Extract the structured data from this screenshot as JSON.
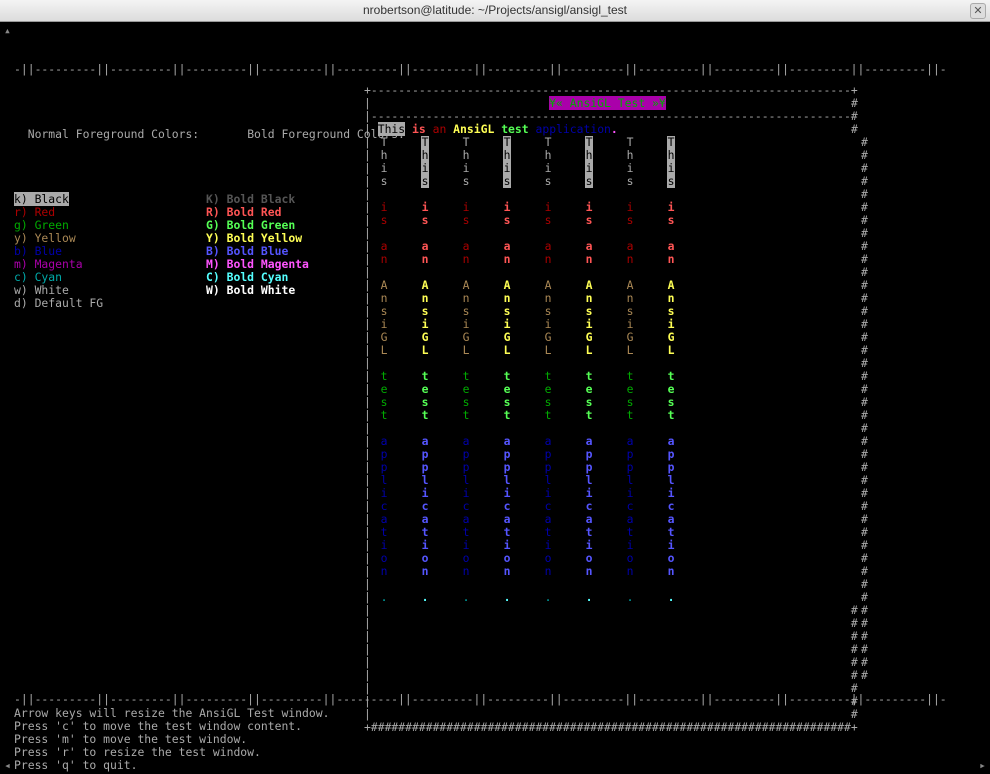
{
  "window": {
    "title": "nrobertson@latitude: ~/Projects/ansigl/ansigl_test"
  },
  "scroll": {
    "up": "▴",
    "left": "◂",
    "right": "▸"
  },
  "ruler": "-||---------||---------||---------||---------||---------||---------||---------||---------||---------||---------||---------||---------||-",
  "headers": {
    "normal": "Normal Foreground Colors:",
    "bold": "Bold Foreground Colors:"
  },
  "normal_colors": [
    {
      "key": "k)",
      "name": "Black",
      "cls": "hl-wht"
    },
    {
      "key": "r)",
      "name": "Red",
      "cls": "red"
    },
    {
      "key": "g)",
      "name": "Green",
      "cls": "grn"
    },
    {
      "key": "y)",
      "name": "Yellow",
      "cls": "ylw"
    },
    {
      "key": "b)",
      "name": "Blue",
      "cls": "blu"
    },
    {
      "key": "m)",
      "name": "Magenta",
      "cls": "mag"
    },
    {
      "key": "c)",
      "name": "Cyan",
      "cls": "cyn"
    },
    {
      "key": "w)",
      "name": "White",
      "cls": "wht"
    },
    {
      "key": "d)",
      "name": "Default FG",
      "cls": "wht"
    }
  ],
  "bold_colors": [
    {
      "key": "K)",
      "name": "Bold Black",
      "cls": "bblk"
    },
    {
      "key": "R)",
      "name": "Bold Red",
      "cls": "bred"
    },
    {
      "key": "G)",
      "name": "Bold Green",
      "cls": "bgrn"
    },
    {
      "key": "Y)",
      "name": "Bold Yellow",
      "cls": "bylw"
    },
    {
      "key": "B)",
      "name": "Bold Blue",
      "cls": "bblu"
    },
    {
      "key": "M)",
      "name": "Bold Magenta",
      "cls": "bmag"
    },
    {
      "key": "C)",
      "name": "Bold Cyan",
      "cls": "bcyn"
    },
    {
      "key": "W)",
      "name": "Bold White",
      "cls": "bwht"
    }
  ],
  "panel": {
    "top": "+----------------------------------------------------------------------+",
    "title": "¥« AnsiGL Test »¥",
    "divider": "|----------------------------------------------------------------------|",
    "bottom": "+######################################################################+",
    "pipe": "|",
    "hash": "#"
  },
  "sentence": [
    {
      "t": "This",
      "cls": "hl-wht"
    },
    {
      "t": " ",
      "cls": ""
    },
    {
      "t": "is",
      "cls": "bred"
    },
    {
      "t": " ",
      "cls": ""
    },
    {
      "t": "an",
      "cls": "red"
    },
    {
      "t": " ",
      "cls": ""
    },
    {
      "t": "AnsiGL",
      "cls": "bylw"
    },
    {
      "t": " ",
      "cls": ""
    },
    {
      "t": "test",
      "cls": "bgrn"
    },
    {
      "t": " ",
      "cls": ""
    },
    {
      "t": "application",
      "cls": "blu"
    },
    {
      "t": ".",
      "cls": "bmag"
    }
  ],
  "vwords": [
    {
      "word": "This",
      "base": "wht",
      "hl": "hl-wht"
    },
    {
      "word": "is",
      "base": "red",
      "hl": "bred"
    },
    {
      "word": "an",
      "base": "red",
      "hl": "red"
    },
    {
      "word": "AnsiGL",
      "base": "ylw",
      "hl": "bylw"
    },
    {
      "word": "test",
      "base": "grn",
      "hl": "bgrn"
    },
    {
      "word": "application",
      "base": "blu",
      "hl": "blu"
    },
    {
      "word": ".",
      "base": "cyn",
      "hl": "bmag"
    }
  ],
  "vcol_styles": [
    "",
    "b",
    "",
    "b",
    "",
    "b",
    "",
    "b"
  ],
  "help": [
    "Arrow keys will resize the AnsiGL Test window.",
    "Press 'c' to move the test window content.",
    "Press 'm' to move the test window.",
    "Press 'r' to resize the test window.",
    "Press 'q' to quit."
  ]
}
